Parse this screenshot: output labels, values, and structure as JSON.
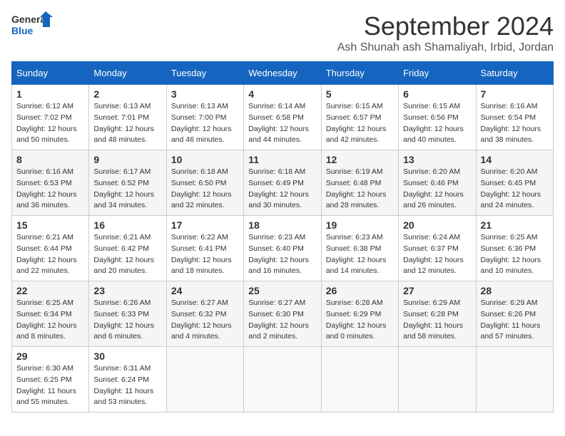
{
  "logo": {
    "line1": "General",
    "line2": "Blue"
  },
  "title": "September 2024",
  "subtitle": "Ash Shunah ash Shamaliyah, Irbid, Jordan",
  "weekdays": [
    "Sunday",
    "Monday",
    "Tuesday",
    "Wednesday",
    "Thursday",
    "Friday",
    "Saturday"
  ],
  "weeks": [
    [
      {
        "day": "1",
        "sunrise": "6:12 AM",
        "sunset": "7:02 PM",
        "daylight": "12 hours and 50 minutes."
      },
      {
        "day": "2",
        "sunrise": "6:13 AM",
        "sunset": "7:01 PM",
        "daylight": "12 hours and 48 minutes."
      },
      {
        "day": "3",
        "sunrise": "6:13 AM",
        "sunset": "7:00 PM",
        "daylight": "12 hours and 46 minutes."
      },
      {
        "day": "4",
        "sunrise": "6:14 AM",
        "sunset": "6:58 PM",
        "daylight": "12 hours and 44 minutes."
      },
      {
        "day": "5",
        "sunrise": "6:15 AM",
        "sunset": "6:57 PM",
        "daylight": "12 hours and 42 minutes."
      },
      {
        "day": "6",
        "sunrise": "6:15 AM",
        "sunset": "6:56 PM",
        "daylight": "12 hours and 40 minutes."
      },
      {
        "day": "7",
        "sunrise": "6:16 AM",
        "sunset": "6:54 PM",
        "daylight": "12 hours and 38 minutes."
      }
    ],
    [
      {
        "day": "8",
        "sunrise": "6:16 AM",
        "sunset": "6:53 PM",
        "daylight": "12 hours and 36 minutes."
      },
      {
        "day": "9",
        "sunrise": "6:17 AM",
        "sunset": "6:52 PM",
        "daylight": "12 hours and 34 minutes."
      },
      {
        "day": "10",
        "sunrise": "6:18 AM",
        "sunset": "6:50 PM",
        "daylight": "12 hours and 32 minutes."
      },
      {
        "day": "11",
        "sunrise": "6:18 AM",
        "sunset": "6:49 PM",
        "daylight": "12 hours and 30 minutes."
      },
      {
        "day": "12",
        "sunrise": "6:19 AM",
        "sunset": "6:48 PM",
        "daylight": "12 hours and 28 minutes."
      },
      {
        "day": "13",
        "sunrise": "6:20 AM",
        "sunset": "6:46 PM",
        "daylight": "12 hours and 26 minutes."
      },
      {
        "day": "14",
        "sunrise": "6:20 AM",
        "sunset": "6:45 PM",
        "daylight": "12 hours and 24 minutes."
      }
    ],
    [
      {
        "day": "15",
        "sunrise": "6:21 AM",
        "sunset": "6:44 PM",
        "daylight": "12 hours and 22 minutes."
      },
      {
        "day": "16",
        "sunrise": "6:21 AM",
        "sunset": "6:42 PM",
        "daylight": "12 hours and 20 minutes."
      },
      {
        "day": "17",
        "sunrise": "6:22 AM",
        "sunset": "6:41 PM",
        "daylight": "12 hours and 18 minutes."
      },
      {
        "day": "18",
        "sunrise": "6:23 AM",
        "sunset": "6:40 PM",
        "daylight": "12 hours and 16 minutes."
      },
      {
        "day": "19",
        "sunrise": "6:23 AM",
        "sunset": "6:38 PM",
        "daylight": "12 hours and 14 minutes."
      },
      {
        "day": "20",
        "sunrise": "6:24 AM",
        "sunset": "6:37 PM",
        "daylight": "12 hours and 12 minutes."
      },
      {
        "day": "21",
        "sunrise": "6:25 AM",
        "sunset": "6:36 PM",
        "daylight": "12 hours and 10 minutes."
      }
    ],
    [
      {
        "day": "22",
        "sunrise": "6:25 AM",
        "sunset": "6:34 PM",
        "daylight": "12 hours and 8 minutes."
      },
      {
        "day": "23",
        "sunrise": "6:26 AM",
        "sunset": "6:33 PM",
        "daylight": "12 hours and 6 minutes."
      },
      {
        "day": "24",
        "sunrise": "6:27 AM",
        "sunset": "6:32 PM",
        "daylight": "12 hours and 4 minutes."
      },
      {
        "day": "25",
        "sunrise": "6:27 AM",
        "sunset": "6:30 PM",
        "daylight": "12 hours and 2 minutes."
      },
      {
        "day": "26",
        "sunrise": "6:28 AM",
        "sunset": "6:29 PM",
        "daylight": "12 hours and 0 minutes."
      },
      {
        "day": "27",
        "sunrise": "6:29 AM",
        "sunset": "6:28 PM",
        "daylight": "11 hours and 58 minutes."
      },
      {
        "day": "28",
        "sunrise": "6:29 AM",
        "sunset": "6:26 PM",
        "daylight": "11 hours and 57 minutes."
      }
    ],
    [
      {
        "day": "29",
        "sunrise": "6:30 AM",
        "sunset": "6:25 PM",
        "daylight": "11 hours and 55 minutes."
      },
      {
        "day": "30",
        "sunrise": "6:31 AM",
        "sunset": "6:24 PM",
        "daylight": "11 hours and 53 minutes."
      },
      null,
      null,
      null,
      null,
      null
    ]
  ],
  "labels": {
    "sunrise": "Sunrise:",
    "sunset": "Sunset:",
    "daylight": "Daylight:"
  }
}
